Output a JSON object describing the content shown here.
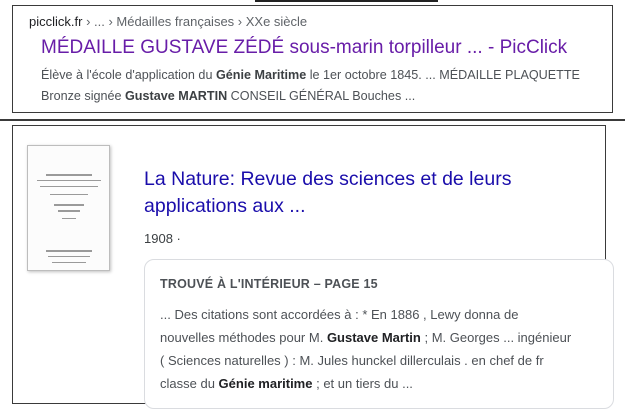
{
  "result1": {
    "domain": "picclick.fr",
    "breadcrumb_rest": " › ... › Médailles françaises › XXe siècle",
    "title": "MÉDAILLE GUSTAVE ZÉDÉ sous-marin torpilleur ... - PicClick",
    "snippet_line1": [
      {
        "t": "Élève à l'école d'application du ",
        "b": false
      },
      {
        "t": "Génie Maritime",
        "b": true
      },
      {
        "t": " le 1er octobre 1845. ... MÉDAILLE PLAQUETTE",
        "b": false
      }
    ],
    "snippet_line2": [
      {
        "t": "Bronze signée ",
        "b": false
      },
      {
        "t": "Gustave MARTIN",
        "b": true
      },
      {
        "t": " CONSEIL GÉNÉRAL Bouches ...",
        "b": false
      }
    ]
  },
  "result2": {
    "title_line1": "La Nature: Revue des sciences et de leurs",
    "title_line2": "applications aux ...",
    "year": "1908 ·",
    "inside": {
      "heading": "TROUVÉ À L'INTÉRIEUR – PAGE 15",
      "lines": [
        [
          {
            "t": "... Des citations sont accordées à : * En 1886 , Lewy donna de",
            "b": false
          }
        ],
        [
          {
            "t": "nouvelles méthodes pour M. ",
            "b": false
          },
          {
            "t": "Gustave Martin",
            "b": true
          },
          {
            "t": " ; M. Georges ... ingénieur",
            "b": false
          }
        ],
        [
          {
            "t": "( Sciences naturelles ) : M. Jules hunckel dillerculais . en chef de fr",
            "b": false
          }
        ],
        [
          {
            "t": "classe du ",
            "b": false
          },
          {
            "t": "Génie maritime",
            "b": true
          },
          {
            "t": " ; et un tiers du ...",
            "b": false
          }
        ]
      ]
    }
  },
  "colors": {
    "visited_link": "#681da8",
    "link": "#1a0dab",
    "snippet": "#4d5156"
  }
}
